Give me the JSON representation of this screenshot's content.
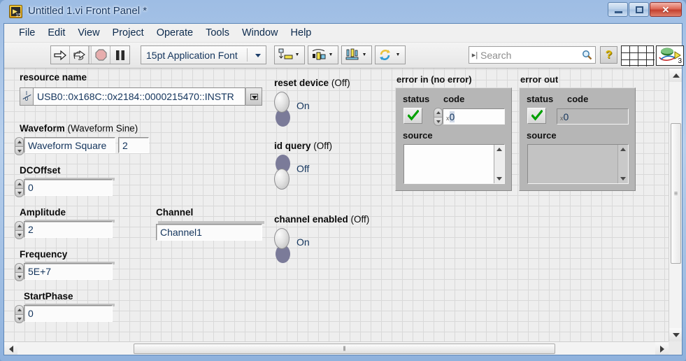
{
  "window": {
    "title": "Untitled 1.vi Front Panel *",
    "app_icon": "labview-vi-icon",
    "buttons": {
      "minimize": "minimize-icon",
      "maximize": "maximize-icon",
      "close": "✕"
    }
  },
  "menu": {
    "items": [
      "File",
      "Edit",
      "View",
      "Project",
      "Operate",
      "Tools",
      "Window",
      "Help"
    ]
  },
  "toolbar": {
    "run": "run-arrow-icon",
    "run_continuously": "run-continuously-icon",
    "abort": "abort-execution-icon",
    "pause": "pause-icon",
    "font_selector": "15pt Application Font",
    "align_objects": "align-objects-icon",
    "distribute_objects": "distribute-objects-icon",
    "resize_objects": "resize-objects-icon",
    "reorder": "reorder-icon",
    "search_placeholder": "Search",
    "search_value": "",
    "help_label": "?",
    "connector_pane": "connector-pane-icon",
    "vi_icon_number": "3"
  },
  "controls": {
    "resource_name": {
      "label": "resource name",
      "value": "USB0::0x168C::0x2184::0000215470::INSTR",
      "io_glyph_top": "I",
      "io_glyph_bottom": "0"
    },
    "waveform": {
      "label": "Waveform",
      "label_suffix": "(Waveform Sine)",
      "value": "Waveform Square",
      "numeric": "2"
    },
    "dcoffset": {
      "label": "DCOffset",
      "value": "0"
    },
    "amplitude": {
      "label": "Amplitude",
      "value": "2"
    },
    "frequency": {
      "label": "Frequency",
      "value": "5E+7"
    },
    "startphase": {
      "label": "StartPhase",
      "value": "0"
    },
    "channel": {
      "label": "Channel",
      "value": "Channel1"
    }
  },
  "switches": [
    {
      "label": "reset device",
      "label_suffix": "(Off)",
      "state_text": "On",
      "position": "up"
    },
    {
      "label": "id query",
      "label_suffix": "(Off)",
      "state_text": "Off",
      "position": "down"
    },
    {
      "label": "channel enabled",
      "label_suffix": "(Off)",
      "state_text": "On",
      "position": "up"
    }
  ],
  "error_in": {
    "label": "error in",
    "label_suffix": "(no error)",
    "status_label": "status",
    "status_icon": "green-check-icon",
    "code_label": "code",
    "code_prefix": "x",
    "code_value": "0",
    "source_label": "source",
    "source_value": ""
  },
  "error_out": {
    "label": "error out",
    "label_suffix": "",
    "status_label": "status",
    "status_icon": "green-check-icon",
    "code_label": "code",
    "code_prefix": "x",
    "code_value": "0",
    "source_label": "source",
    "source_value": ""
  },
  "scrollbars": {
    "vertical_grip": "≡",
    "horizontal_grip": "⦀"
  },
  "colors": {
    "title_gradient_top": "#9ebde4",
    "canvas": "#eeeeee",
    "grid_line": "#d9d9d9",
    "cluster_gray": "#b6b6b6",
    "label_blue": "#13345c",
    "status_green": "#00a000",
    "close_red": "#c4402f"
  }
}
